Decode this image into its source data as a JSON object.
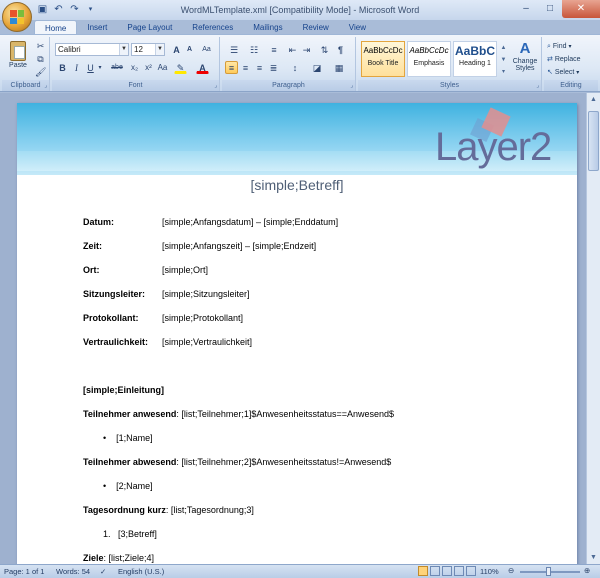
{
  "window": {
    "title": "WordMLTemplate.xml [Compatibility Mode] - Microsoft Word",
    "minimize": "–",
    "maximize": "□",
    "close": "✕"
  },
  "tabs": [
    {
      "label": "Home",
      "active": true
    },
    {
      "label": "Insert"
    },
    {
      "label": "Page Layout"
    },
    {
      "label": "References"
    },
    {
      "label": "Mailings"
    },
    {
      "label": "Review"
    },
    {
      "label": "View"
    }
  ],
  "ribbon": {
    "clipboard": {
      "label": "Clipboard",
      "paste": "Paste"
    },
    "font": {
      "label": "Font",
      "name": "Calibri",
      "size": "12",
      "bold": "B",
      "italic": "I",
      "underline": "U",
      "strike": "abe",
      "subscript": "x₂",
      "superscript": "x²",
      "clear": "Aa",
      "grow": "A",
      "shrink": "A"
    },
    "paragraph": {
      "label": "Paragraph"
    },
    "styles": {
      "label": "Styles",
      "items": [
        {
          "preview": "AaBbCcDc",
          "name": "Book Title"
        },
        {
          "preview": "AaBbCcDc",
          "name": "Emphasis"
        },
        {
          "preview": "AaBbC",
          "name": "Heading 1"
        }
      ],
      "change": "Change",
      "change2": "Styles"
    },
    "editing": {
      "label": "Editing",
      "find": "Find",
      "replace": "Replace",
      "select": "Select"
    }
  },
  "document": {
    "subject": "[simple;Betreff]",
    "fields": [
      {
        "label": "Datum:",
        "value": "[simple;Anfangsdatum] – [simple;Enddatum]"
      },
      {
        "label": "Zeit:",
        "value": "[simple;Anfangszeit] – [simple;Endzeit]"
      },
      {
        "label": "Ort:",
        "value": "[simple;Ort]"
      },
      {
        "label": "Sitzungsleiter:",
        "value": "[simple;Sitzungsleiter]"
      },
      {
        "label": "Protokollant:",
        "value": "[simple;Protokollant]"
      },
      {
        "label": "Vertraulichkeit:",
        "value": "[simple;Vertraulichkeit]"
      }
    ],
    "intro": "[simple;Einleitung]",
    "present_label": "Teilnehmer anwesend",
    "present_value": ": [list;Teilnehmer;1]$Anwesenheitsstatus==Anwesend$",
    "present_item": "[1;Name]",
    "absent_label": "Teilnehmer abwesend",
    "absent_value": ": [list;Teilnehmer;2]$Anwesenheitsstatus!=Anwesend$",
    "absent_item": "[2;Name]",
    "agenda_label": "Tagesordnung kurz",
    "agenda_value": ": [list;Tagesordnung;3]",
    "agenda_num": "1.",
    "agenda_item": "[3;Betreff]",
    "goals_label": "Ziele",
    "goals_value": ": [list;Ziele;4]",
    "logo": "Layer2"
  },
  "statusbar": {
    "page": "Page: 1 of 1",
    "words": "Words: 54",
    "language": "English (U.S.)",
    "zoom": "110%"
  }
}
